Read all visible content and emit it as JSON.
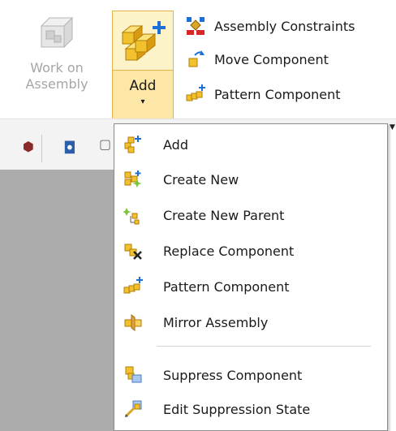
{
  "ribbon": {
    "work_on_assembly": {
      "line1": "Work on",
      "line2": "Assembly",
      "icon": "assembly-cube-icon",
      "enabled": false
    },
    "add_button": {
      "label": "Add",
      "arrow": "▾",
      "icon": "add-component-icon"
    },
    "side_items": [
      {
        "label": "Assembly Constraints",
        "icon": "assembly-constraints-icon"
      },
      {
        "label": "Move Component",
        "icon": "move-component-icon"
      },
      {
        "label": "Pattern Component",
        "icon": "pattern-component-icon"
      }
    ]
  },
  "toolbar": {
    "glyph_left": "⬢",
    "glyph_mid": "◘",
    "glyph_right": "▢"
  },
  "menu": {
    "items": [
      {
        "label": "Add",
        "icon": "add-icon"
      },
      {
        "label": "Create New",
        "icon": "create-new-icon"
      },
      {
        "label": "Create New Parent",
        "icon": "create-new-parent-icon"
      },
      {
        "label": "Replace Component",
        "icon": "replace-component-icon"
      },
      {
        "label": "Pattern Component",
        "icon": "pattern-component-icon"
      },
      {
        "label": "Mirror Assembly",
        "icon": "mirror-assembly-icon"
      },
      {
        "label": "Suppress Component",
        "icon": "suppress-component-icon"
      },
      {
        "label": "Edit Suppression State",
        "icon": "edit-suppression-state-icon"
      }
    ]
  },
  "colors": {
    "highlight_fill": "#fdf3c8",
    "highlight_border": "#e6b24a",
    "canvas": "#acacac",
    "disabled_text": "#a6a6a6",
    "cube_yellow": "#f2c12e",
    "plus_blue": "#1c6fd6"
  }
}
